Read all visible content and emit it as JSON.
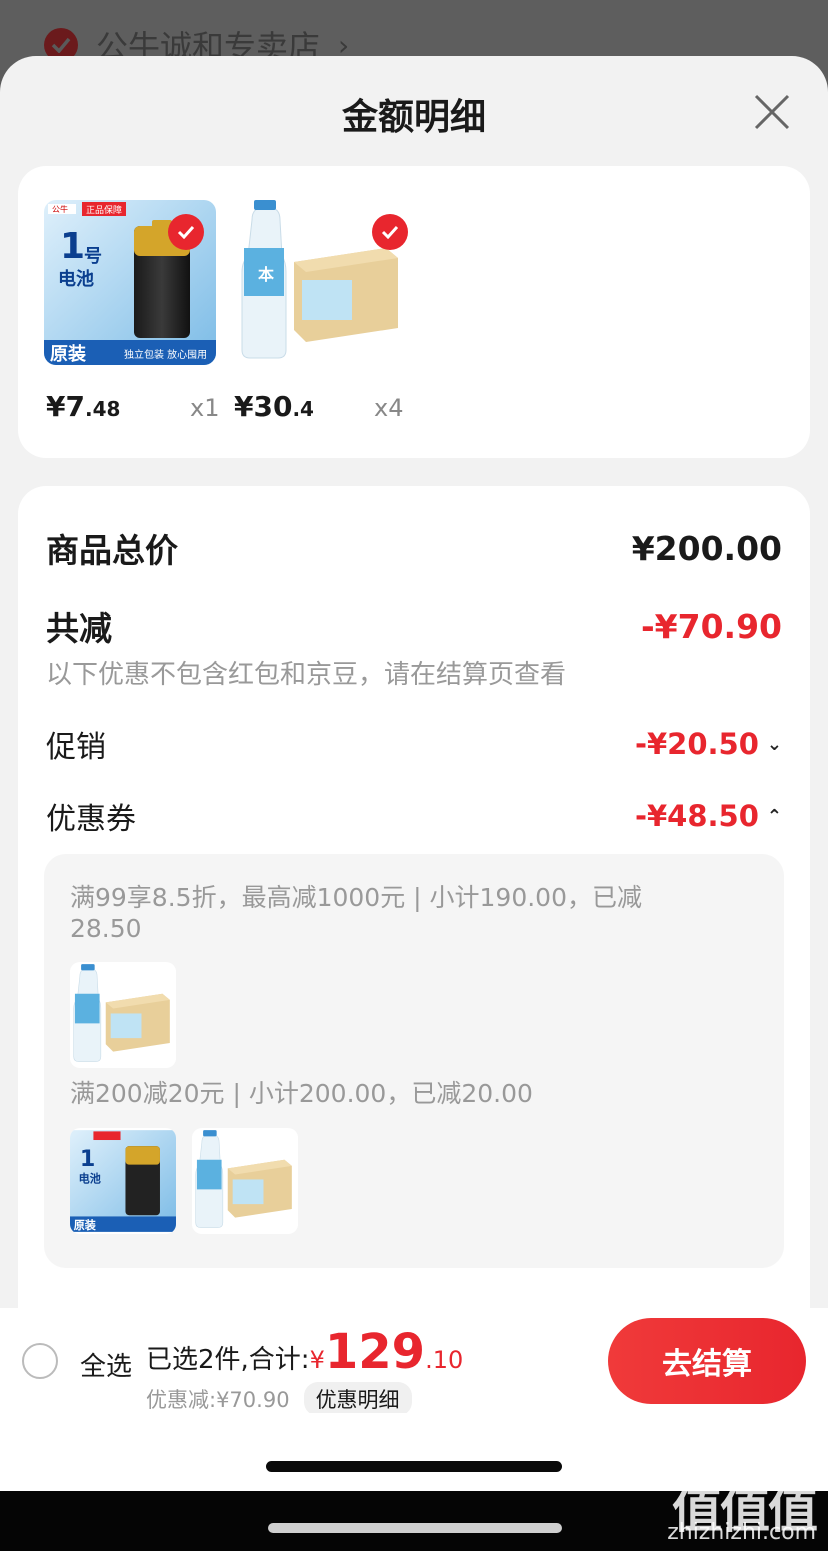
{
  "store": {
    "name": "公牛诚和专卖店",
    "chevron": "›"
  },
  "sheet": {
    "title": "金额明细",
    "close_icon": "close-icon"
  },
  "products": [
    {
      "name": "1号电池",
      "badge": "正品保障",
      "brand": "公牛",
      "tag": "原装",
      "sub": "独立包装 放心囤用",
      "price_int": "¥7",
      "price_dec": ".48",
      "qty": "x1",
      "checked": true
    },
    {
      "name": "饮用水整箱",
      "price_int": "¥30",
      "price_dec": ".4",
      "qty": "x4",
      "checked": true
    }
  ],
  "summary": {
    "total_label": "商品总价",
    "total_value": "¥200.00",
    "reduce_label": "共减",
    "reduce_value": "-¥70.90",
    "note": "以下优惠不包含红包和京豆，请在结算页查看",
    "promo_label": "促销",
    "promo_value": "-¥20.50",
    "coupon_label": "优惠券",
    "coupon_value": "-¥48.50"
  },
  "coupons": [
    {
      "text": "满99享8.5折，最高减1000元 | 小计190.00，已减28.50"
    },
    {
      "text": "满200减20元 | 小计200.00，已减20.00"
    }
  ],
  "bottom": {
    "select_all": "全选",
    "selected_text": "已选2件,合计:",
    "currency": "¥",
    "total_int": "129",
    "total_dec": ".10",
    "discount_text": "优惠减:¥70.90",
    "detail_chip": "优惠明细",
    "checkout": "去结算"
  },
  "watermark": {
    "logo": "值值值",
    "url": "zhizhizhi.com"
  },
  "colors": {
    "accent": "#e8262e",
    "background": "#f2f2f2"
  }
}
